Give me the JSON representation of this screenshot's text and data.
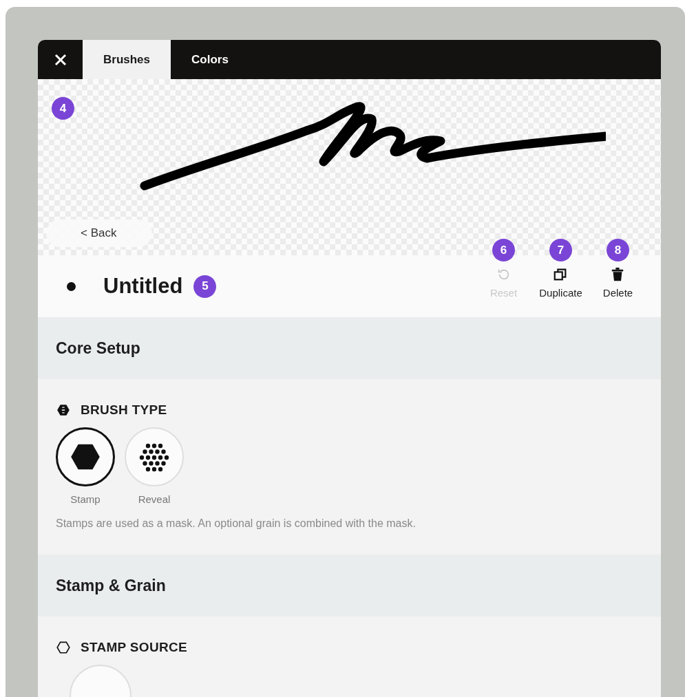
{
  "tabs": [
    {
      "label": "Brushes",
      "selected": true
    },
    {
      "label": "Colors",
      "selected": false
    }
  ],
  "preview": {
    "marker": "4",
    "back_label": "< Back"
  },
  "brush": {
    "name": "Untitled",
    "marker": "5"
  },
  "actions": [
    {
      "label": "Reset",
      "marker": "6",
      "kind": "reset",
      "disabled": true
    },
    {
      "label": "Duplicate",
      "marker": "7",
      "kind": "duplicate",
      "disabled": false
    },
    {
      "label": "Delete",
      "marker": "8",
      "kind": "delete",
      "disabled": false
    }
  ],
  "sections": [
    {
      "title": "Core Setup",
      "heading": "BRUSH TYPE",
      "options": [
        {
          "label": "Stamp",
          "kind": "solid",
          "selected": true
        },
        {
          "label": "Reveal",
          "kind": "dots",
          "selected": false
        }
      ],
      "description": "Stamps are used as a mask. An optional grain is combined with the mask."
    },
    {
      "title": "Stamp & Grain",
      "heading": "STAMP SOURCE"
    }
  ]
}
